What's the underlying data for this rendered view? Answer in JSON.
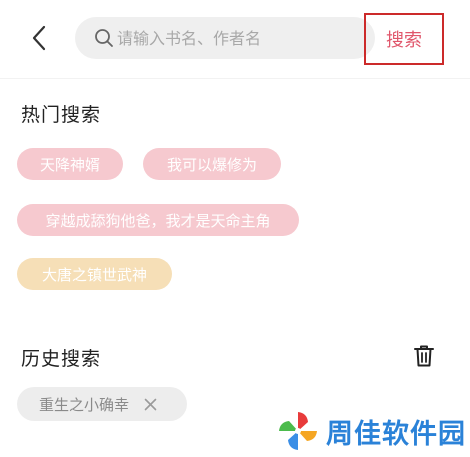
{
  "header": {
    "search_placeholder": "请输入书名、作者名",
    "search_value": "",
    "search_button_label": "搜索"
  },
  "hot_search": {
    "title": "热门搜索",
    "tags": [
      {
        "label": "天降神婿",
        "color": "#f6c9cf"
      },
      {
        "label": "我可以爆修为",
        "color": "#f6c9cf"
      },
      {
        "label": "穿越成舔狗他爸，我才是天命主角",
        "color": "#f6c9cf"
      },
      {
        "label": "大唐之镇世武神",
        "color": "#f6dfb7"
      }
    ]
  },
  "history_search": {
    "title": "历史搜索",
    "items": [
      {
        "label": "重生之小确幸"
      }
    ]
  },
  "watermark": {
    "text": "周佳软件园"
  },
  "colors": {
    "accent": "#e0566b",
    "highlight_border": "#cc2a2a",
    "watermark_blue": "#2a82d8"
  }
}
